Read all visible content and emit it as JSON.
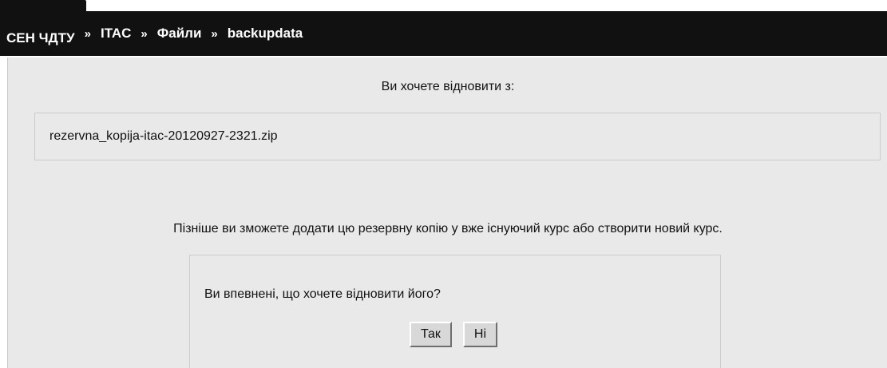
{
  "breadcrumb": {
    "items": [
      "СЕН ЧДТУ",
      "ITAC",
      "Файли",
      "backupdata"
    ],
    "separator": "»"
  },
  "restore": {
    "prompt": "Ви хочете відновити з:",
    "file_name": "rezervna_kopija-itac-20120927-2321.zip",
    "info": "Пізніше ви зможете додати цю резервну копію у вже існуючий курс або створити новий курс."
  },
  "confirm": {
    "question": "Ви впевнені, що хочете відновити його?",
    "yes_label": "Так",
    "no_label": "Ні"
  },
  "colors": {
    "header": "#111111",
    "panel": "#e9e9e9",
    "border": "#cccccc"
  }
}
